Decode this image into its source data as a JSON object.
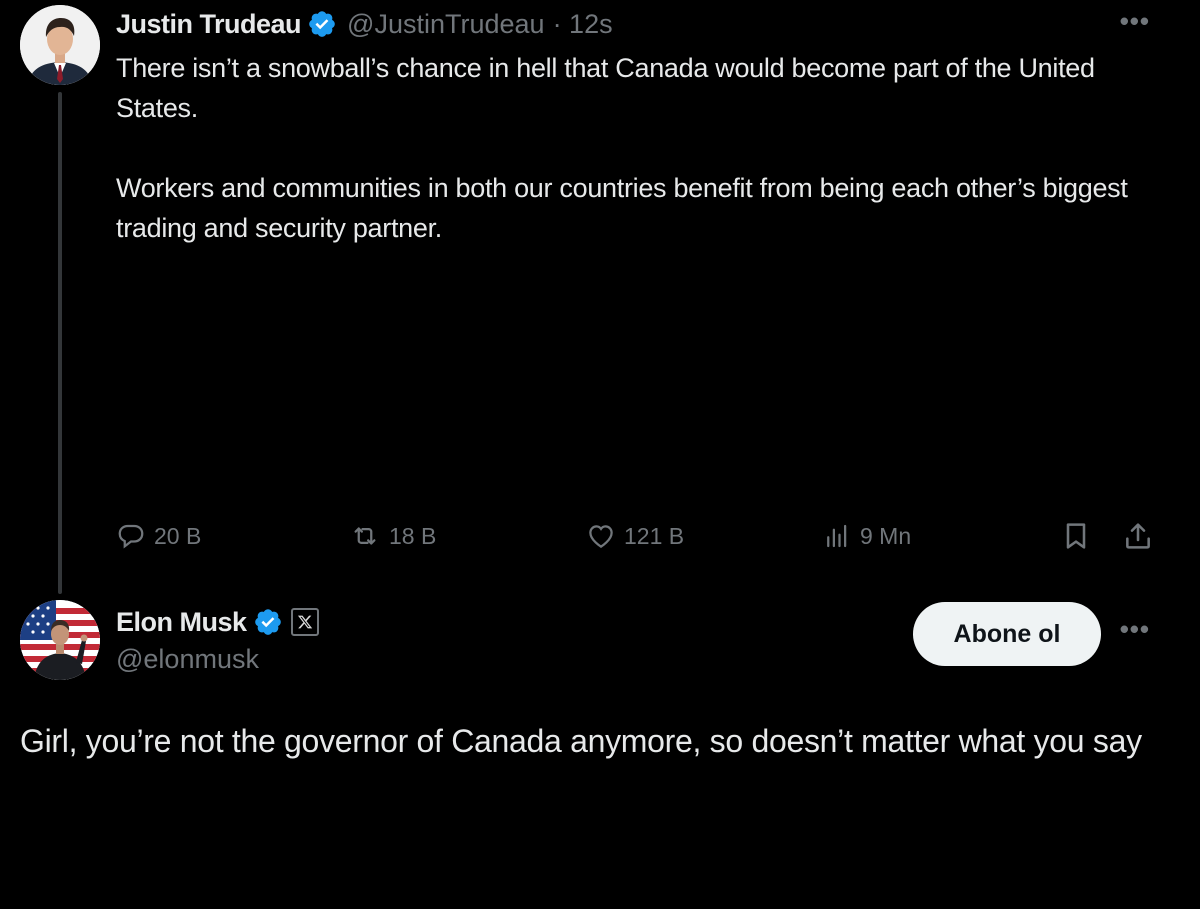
{
  "tweet": {
    "author": {
      "name": "Justin Trudeau",
      "handle": "@JustinTrudeau",
      "time": "· 12s",
      "avatar": "trudeau-avatar"
    },
    "more_icon": "more-dots-icon",
    "paragraphs": [
      "There isn’t a snowball’s chance in hell that Canada would become part of the United States.",
      "Workers and communities in both our countries benefit from being each other’s biggest trading and security partner."
    ],
    "actions": {
      "replies": "20 B",
      "reposts": "18 B",
      "likes": "121 B",
      "views": "9 Mn"
    }
  },
  "reply": {
    "author": {
      "name": "Elon Musk",
      "handle": "@elonmusk",
      "avatar": "musk-avatar",
      "affiliation_badge": "x-logo-icon"
    },
    "follow_label": "Abone ol",
    "text": "Girl, you’re not the governor of Canada anymore, so doesn’t matter what you say"
  },
  "colors": {
    "background": "#000000",
    "text": "#e7e9ea",
    "muted": "#71767b",
    "verified": "#1d9bf0",
    "thread_line": "#333639",
    "follow_button_bg": "#eff3f4"
  }
}
